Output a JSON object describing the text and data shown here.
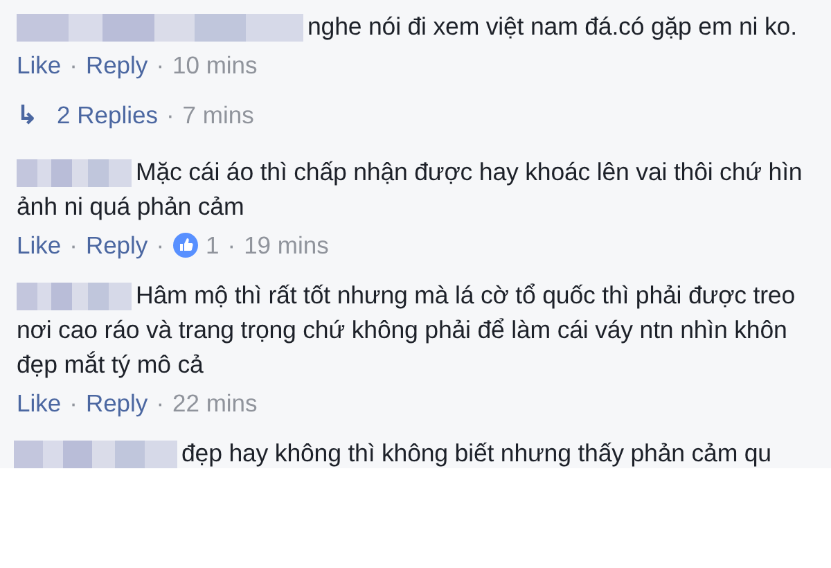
{
  "comments": [
    {
      "lines": [
        "nghe nói đi xem việt nam đá.có gặp em ni ko."
      ],
      "actions": [
        {
          "kind": "link",
          "text": "Like"
        },
        {
          "kind": "sep",
          "text": "·"
        },
        {
          "kind": "link",
          "text": "Reply"
        },
        {
          "kind": "sep",
          "text": "·"
        },
        {
          "kind": "time",
          "text": "10 mins"
        }
      ],
      "replies": {
        "arrow": "↳",
        "items": [
          {
            "kind": "link",
            "text": "2 Replies"
          },
          {
            "kind": "sep",
            "text": "·"
          },
          {
            "kind": "time",
            "text": "7 mins"
          }
        ]
      }
    },
    {
      "lines": [
        "Mặc cái áo thì chấp nhận được hay khoác lên vai thôi chứ hìn",
        "ảnh ni quá phản cảm"
      ],
      "actions": [
        {
          "kind": "link",
          "text": "Like"
        },
        {
          "kind": "sep",
          "text": "·"
        },
        {
          "kind": "link",
          "text": "Reply"
        },
        {
          "kind": "sep",
          "text": "·"
        },
        {
          "kind": "reactions",
          "text": "1"
        },
        {
          "kind": "sep",
          "text": "·"
        },
        {
          "kind": "time",
          "text": "19 mins"
        }
      ]
    },
    {
      "lines": [
        "Hâm mộ thì rất tốt nhưng mà lá cờ tổ quốc thì phải được treo",
        "nơi cao ráo và trang trọng chứ không phải để làm cái váy ntn nhìn khôn",
        "đẹp mắt tý mô cả"
      ],
      "actions": [
        {
          "kind": "link",
          "text": "Like"
        },
        {
          "kind": "sep",
          "text": "·"
        },
        {
          "kind": "link",
          "text": "Reply"
        },
        {
          "kind": "sep",
          "text": "·"
        },
        {
          "kind": "time",
          "text": "22 mins"
        }
      ]
    },
    {
      "lines": [
        "đẹp hay không thì không biết nhưng thấy phản cảm qu"
      ]
    }
  ]
}
